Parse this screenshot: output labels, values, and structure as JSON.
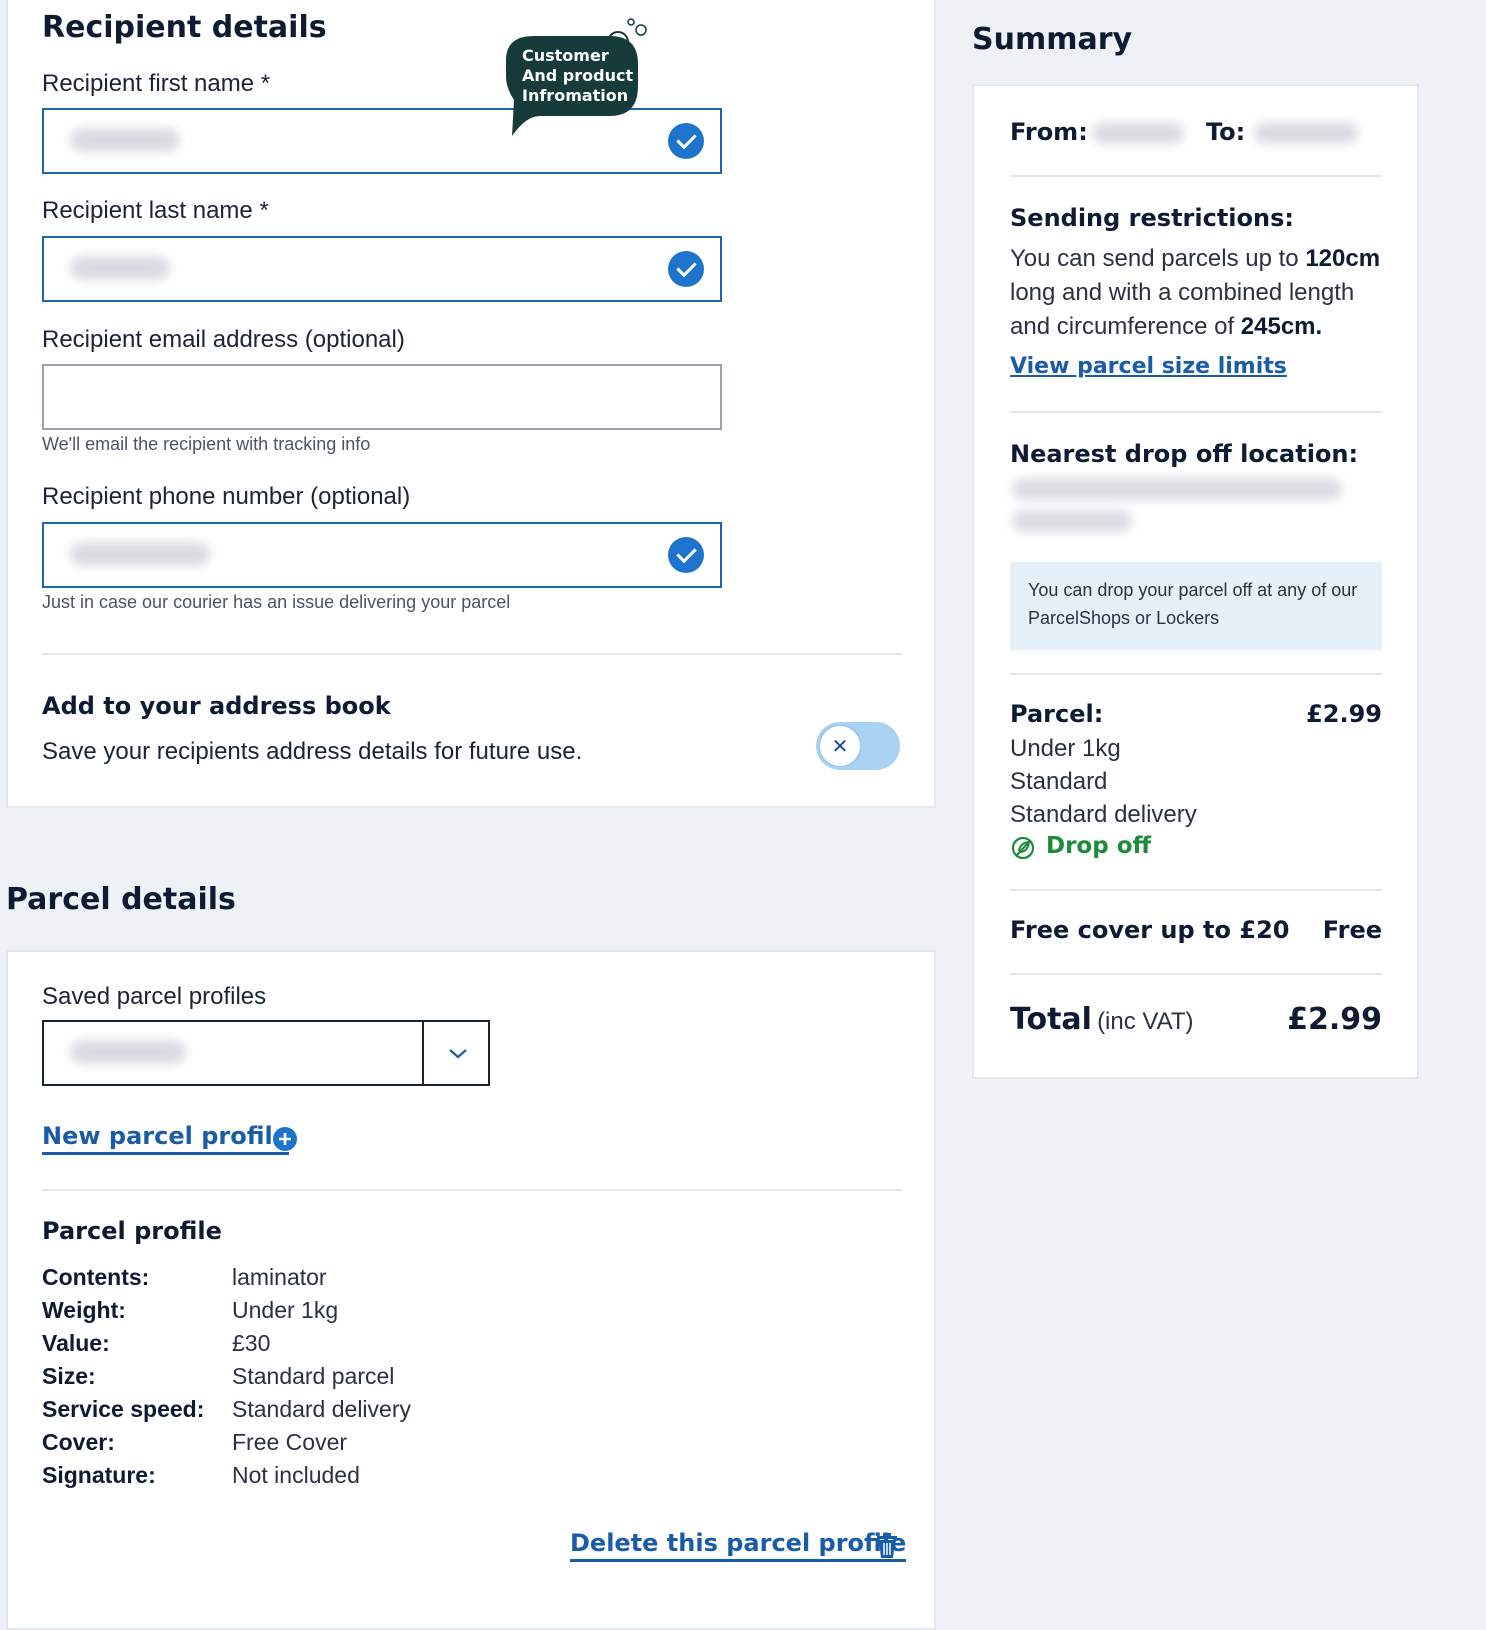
{
  "recipient": {
    "title": "Recipient details",
    "first_name_label": "Recipient first name *",
    "last_name_label": "Recipient last name *",
    "email_label": "Recipient email address (optional)",
    "email_hint": "We'll email the recipient with tracking info",
    "phone_label": "Recipient phone number (optional)",
    "phone_hint": "Just in case our courier has an issue delivering your parcel",
    "address_book_title": "Add to your address book",
    "address_book_desc": "Save your recipients address details for future use.",
    "toggle_state": "off"
  },
  "callout": {
    "line1": "Customer",
    "line2": "And product",
    "line3": "Infromation"
  },
  "parcel": {
    "title": "Parcel details",
    "saved_profiles_label": "Saved parcel profiles",
    "new_profile_link": "New parcel profile",
    "profile_title": "Parcel profile",
    "profile": [
      {
        "key": "Contents:",
        "value": "laminator"
      },
      {
        "key": "Weight:",
        "value": "Under 1kg"
      },
      {
        "key": "Value:",
        "value": "£30"
      },
      {
        "key": "Size:",
        "value": "Standard parcel"
      },
      {
        "key": "Service speed:",
        "value": "Standard delivery"
      },
      {
        "key": "Cover:",
        "value": "Free Cover"
      },
      {
        "key": "Signature:",
        "value": "Not included"
      }
    ],
    "delete_link": "Delete this parcel profile"
  },
  "summary": {
    "title": "Summary",
    "from_label": "From:",
    "to_label": "To:",
    "restrictions_title": "Sending restrictions:",
    "restrictions_text_1": "You can send parcels up to ",
    "restrictions_bold_1": "120cm",
    "restrictions_text_2": " long and with a combined length and circumference of ",
    "restrictions_bold_2": "245cm.",
    "size_limits_link": "View parcel size limits",
    "nearest_title": "Nearest drop off location:",
    "drop_info": "You can drop your parcel off at any of our ParcelShops or Lockers",
    "parcel_label": "Parcel:",
    "parcel_price": "£2.99",
    "parcel_lines": [
      "Under 1kg",
      "Standard",
      "Standard delivery"
    ],
    "drop_off_label": "Drop off",
    "cover_label": "Free cover up to £20",
    "cover_value": "Free",
    "total_label": "Total",
    "total_suffix": "(inc VAT)",
    "total_value": "£2.99"
  },
  "colors": {
    "accent": "#1e74cc",
    "link": "#1a5ca8",
    "green": "#1e8a3c",
    "callout": "#173a3a"
  }
}
